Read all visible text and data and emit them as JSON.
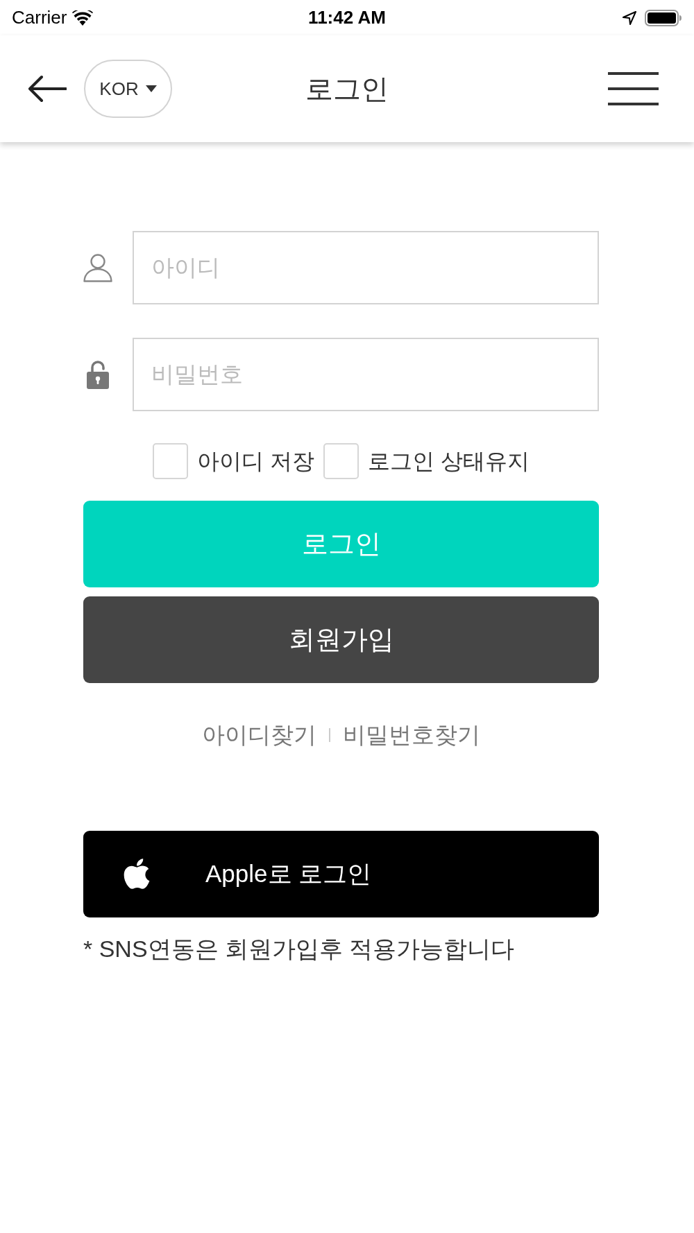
{
  "status_bar": {
    "carrier": "Carrier",
    "time": "11:42 AM"
  },
  "header": {
    "language": "KOR",
    "title": "로그인"
  },
  "form": {
    "fields": [
      {
        "kind": "user",
        "placeholder": "아이디"
      },
      {
        "kind": "password",
        "placeholder": "비밀번호"
      }
    ],
    "options": [
      {
        "label": "아이디 저장",
        "checked": false
      },
      {
        "label": "로그인 상태유지",
        "checked": false
      }
    ],
    "buttons": [
      {
        "kind": "primary",
        "label": "로그인"
      },
      {
        "kind": "secondary",
        "label": "회원가입"
      }
    ],
    "links": [
      "아이디찾기",
      "비밀번호찾기"
    ]
  },
  "sns": {
    "buttons": [
      {
        "kind": "apple",
        "label": "Apple로 로그인"
      }
    ],
    "note": "* SNS연동은 회원가입후 적용가능합니다"
  }
}
